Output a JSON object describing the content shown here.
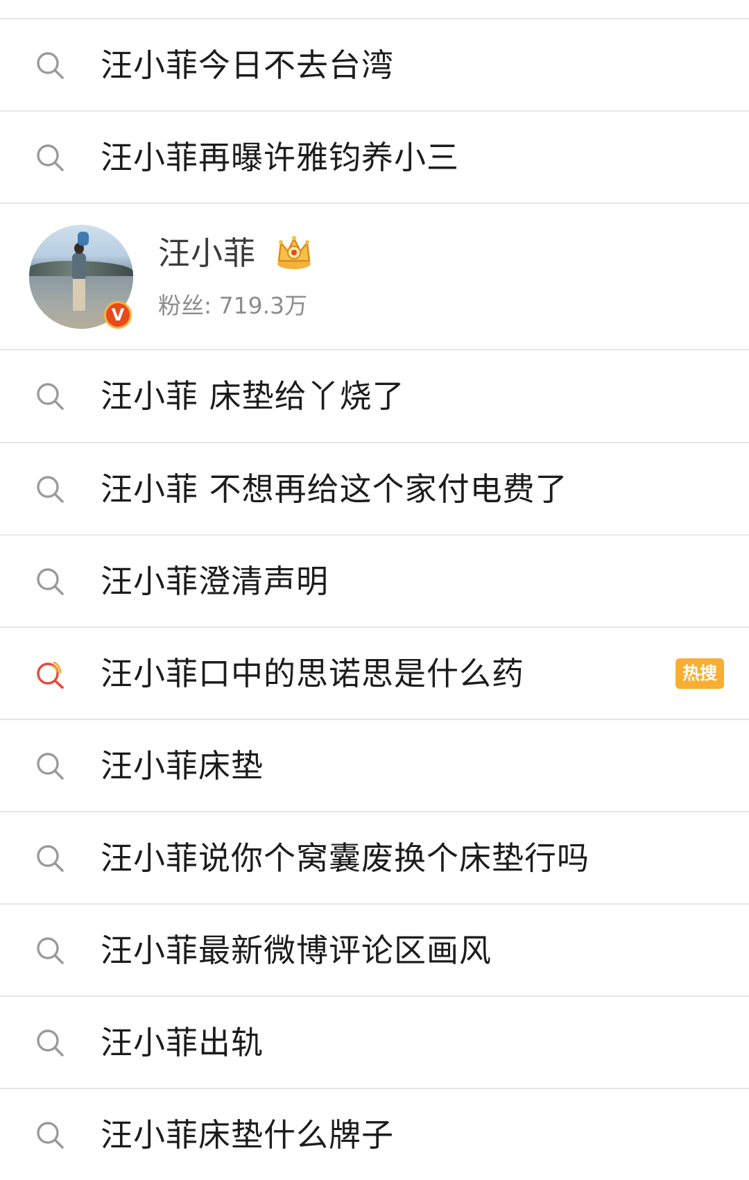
{
  "suggestions_top": [
    {
      "text": "汪小菲今日不去台湾",
      "hot": false
    },
    {
      "text": "汪小菲再曝许雅钧养小三",
      "hot": false
    }
  ],
  "user_card": {
    "name": "汪小菲",
    "fans_label": "粉丝: ",
    "fans_count": "719.3万",
    "verified_mark": "V",
    "badge_icon": "crown-icon",
    "verified_color": "#e8491b"
  },
  "suggestions_bottom": [
    {
      "text": "汪小菲 床垫给丫烧了",
      "hot": false
    },
    {
      "text": "汪小菲 不想再给这个家付电费了",
      "hot": false
    },
    {
      "text": "汪小菲澄清声明",
      "hot": false
    },
    {
      "text": "汪小菲口中的思诺思是什么药",
      "hot": true,
      "badge": "热搜"
    },
    {
      "text": "汪小菲床垫",
      "hot": false
    },
    {
      "text": "汪小菲说你个窝囊废换个床垫行吗",
      "hot": false
    },
    {
      "text": "汪小菲最新微博评论区画风",
      "hot": false
    },
    {
      "text": "汪小菲出轨",
      "hot": false
    },
    {
      "text": "汪小菲床垫什么牌子",
      "hot": false
    }
  ],
  "icons": {
    "search": "search-icon",
    "hot_search": "hot-search-icon"
  },
  "colors": {
    "hot_badge": "#f8ae32",
    "hot_icon": "#e9453c",
    "search_icon": "#9a9a9a",
    "divider": "#e6e6e6"
  }
}
